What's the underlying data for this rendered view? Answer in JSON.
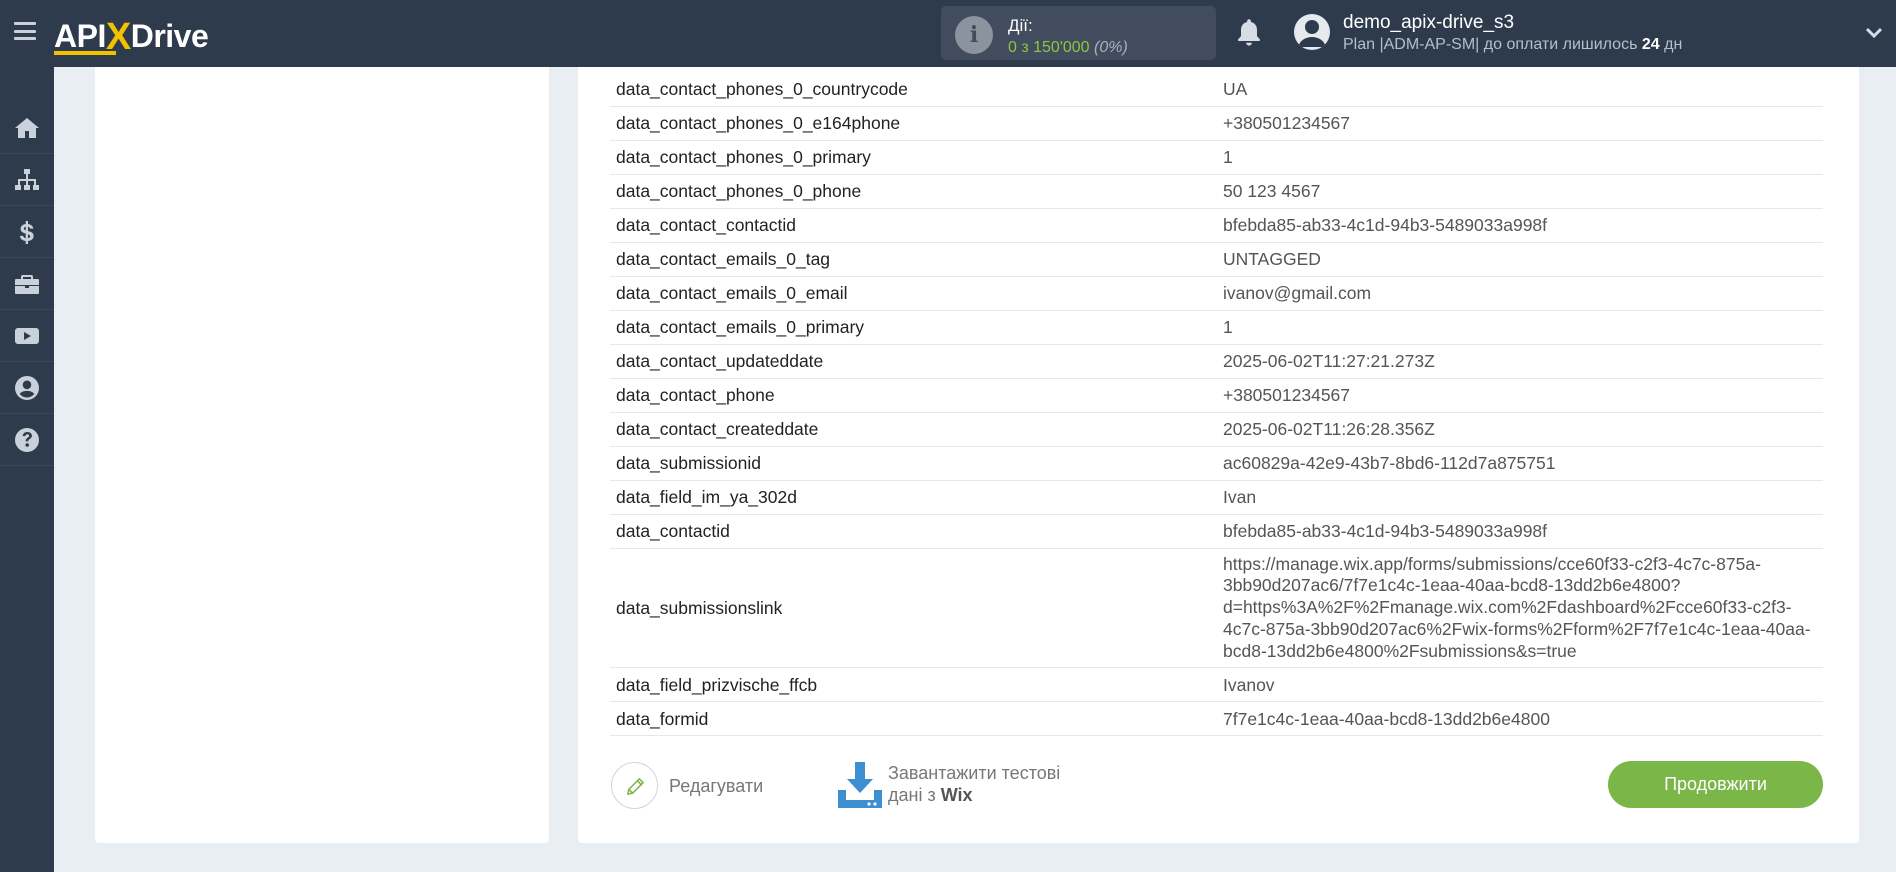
{
  "header": {
    "logo_text_left": "API",
    "logo_text_x": "X",
    "logo_text_right": "Drive",
    "actions_label": "Дії:",
    "actions_value": "0 з 150'000",
    "actions_percent": "(0%)",
    "user_name": "demo_apix-drive_s3",
    "user_plan_prefix": "Plan |ADM-AP-SM| до оплати лишилось ",
    "user_plan_days": "24",
    "user_plan_suffix": " дн"
  },
  "sidebar": {
    "items": [
      {
        "icon": "home-icon"
      },
      {
        "icon": "sitemap-icon"
      },
      {
        "icon": "dollar-icon"
      },
      {
        "icon": "briefcase-icon"
      },
      {
        "icon": "youtube-icon"
      },
      {
        "icon": "user-icon"
      },
      {
        "icon": "help-icon"
      }
    ]
  },
  "fields": [
    {
      "key": "data_contact_phones_0_countrycode",
      "value": "UA"
    },
    {
      "key": "data_contact_phones_0_e164phone",
      "value": "+380501234567"
    },
    {
      "key": "data_contact_phones_0_primary",
      "value": "1"
    },
    {
      "key": "data_contact_phones_0_phone",
      "value": "50 123 4567"
    },
    {
      "key": "data_contact_contactid",
      "value": "bfebda85-ab33-4c1d-94b3-5489033a998f"
    },
    {
      "key": "data_contact_emails_0_tag",
      "value": "UNTAGGED"
    },
    {
      "key": "data_contact_emails_0_email",
      "value": "ivanov@gmail.com"
    },
    {
      "key": "data_contact_emails_0_primary",
      "value": "1"
    },
    {
      "key": "data_contact_updateddate",
      "value": "2025-06-02T11:27:21.273Z"
    },
    {
      "key": "data_contact_phone",
      "value": "+380501234567"
    },
    {
      "key": "data_contact_createddate",
      "value": "2025-06-02T11:26:28.356Z"
    },
    {
      "key": "data_submissionid",
      "value": "ac60829a-42e9-43b7-8bd6-112d7a875751"
    },
    {
      "key": "data_field_im_ya_302d",
      "value": "Ivan"
    },
    {
      "key": "data_contactid",
      "value": "bfebda85-ab33-4c1d-94b3-5489033a998f"
    },
    {
      "key": "data_submissionslink",
      "value_lines": [
        "https://manage.wix.app/forms/submissions/cce60f33-c2f3-4c7c-875a-",
        "3bb90d207ac6/7f7e1c4c-1eaa-40aa-bcd8-13dd2b6e4800?",
        "d=https%3A%2F%2Fmanage.wix.com%2Fdashboard%2Fcce60f33-c2f3-",
        "4c7c-875a-3bb90d207ac6%2Fwix-forms%2Fform%2F7f7e1c4c-1eaa-40aa-",
        "bcd8-13dd2b6e4800%2Fsubmissions&s=true"
      ]
    },
    {
      "key": "data_field_prizvische_ffcb",
      "value": "Ivanov"
    },
    {
      "key": "data_formid",
      "value": "7f7e1c4c-1eaa-40aa-bcd8-13dd2b6e4800"
    }
  ],
  "actions": {
    "edit_label": "Редагувати",
    "download_line1": "Завантажити тестові",
    "download_line2_prefix": "дані з ",
    "download_source": "Wix",
    "continue_label": "Продовжити"
  },
  "colors": {
    "topbar": "#2e3b4c",
    "accent_green": "#7ab648",
    "logo_yellow": "#f2c200",
    "download_blue": "#3d8fd1"
  }
}
